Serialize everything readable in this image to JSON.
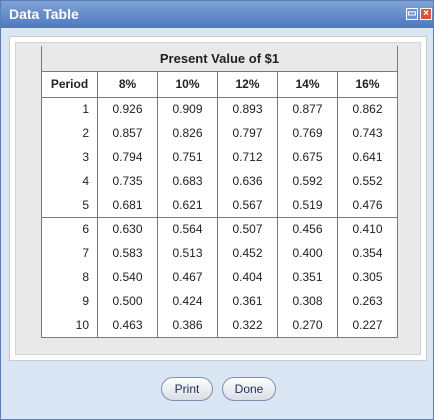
{
  "window": {
    "title": "Data Table"
  },
  "table": {
    "caption": "Present Value of $1",
    "headers": [
      "Period",
      "8%",
      "10%",
      "12%",
      "14%",
      "16%"
    ],
    "rows": [
      [
        "1",
        "0.926",
        "0.909",
        "0.893",
        "0.877",
        "0.862"
      ],
      [
        "2",
        "0.857",
        "0.826",
        "0.797",
        "0.769",
        "0.743"
      ],
      [
        "3",
        "0.794",
        "0.751",
        "0.712",
        "0.675",
        "0.641"
      ],
      [
        "4",
        "0.735",
        "0.683",
        "0.636",
        "0.592",
        "0.552"
      ],
      [
        "5",
        "0.681",
        "0.621",
        "0.567",
        "0.519",
        "0.476"
      ],
      [
        "6",
        "0.630",
        "0.564",
        "0.507",
        "0.456",
        "0.410"
      ],
      [
        "7",
        "0.583",
        "0.513",
        "0.452",
        "0.400",
        "0.354"
      ],
      [
        "8",
        "0.540",
        "0.467",
        "0.404",
        "0.351",
        "0.305"
      ],
      [
        "9",
        "0.500",
        "0.424",
        "0.361",
        "0.308",
        "0.263"
      ],
      [
        "10",
        "0.463",
        "0.386",
        "0.322",
        "0.270",
        "0.227"
      ]
    ]
  },
  "buttons": {
    "print": "Print",
    "done": "Done"
  },
  "icons": {
    "restore": "restore-icon",
    "close": "close-icon"
  },
  "colors": {
    "titlebar": "#4f78c0",
    "close": "#d5553b"
  }
}
